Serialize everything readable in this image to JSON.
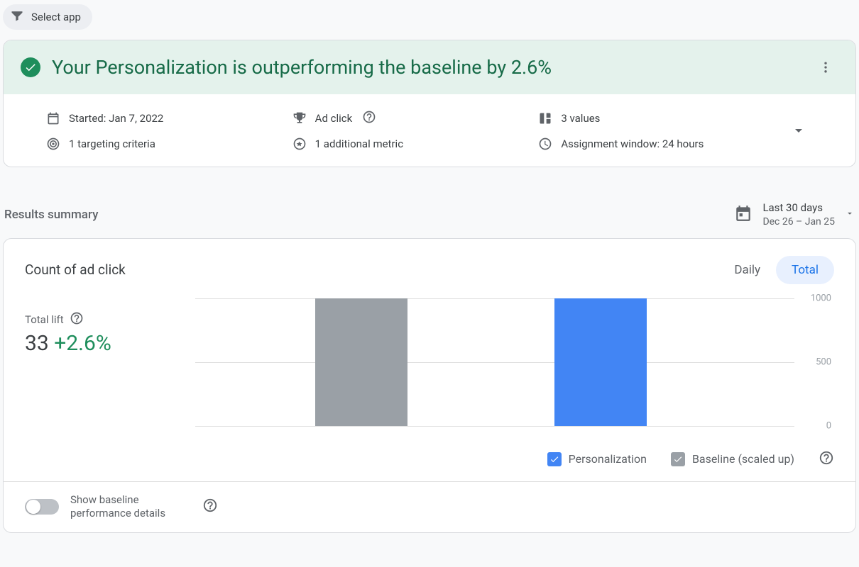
{
  "filter_chip": {
    "label": "Select app"
  },
  "banner": {
    "title": "Your Personalization is outperforming the baseline by 2.6%"
  },
  "meta": {
    "started": "Started: Jan 7, 2022",
    "goal_metric": "Ad click",
    "values": "3 values",
    "targeting": "1 targeting criteria",
    "additional_metric": "1 additional metric",
    "assignment_window": "Assignment window: 24 hours"
  },
  "section_title": "Results summary",
  "date_range": {
    "label": "Last 30 days",
    "range": "Dec 26 – Jan 25"
  },
  "chart": {
    "title": "Count of ad click",
    "tabs": {
      "daily": "Daily",
      "total": "Total",
      "active": "total"
    },
    "lift_label": "Total lift",
    "lift_value": "33",
    "lift_pct": "+2.6%",
    "legend": {
      "personalization": "Personalization",
      "baseline": "Baseline (scaled up)"
    }
  },
  "footer": {
    "switch_label": "Show baseline performance details"
  },
  "chart_data": {
    "type": "bar",
    "categories": [
      "Baseline (scaled up)",
      "Personalization"
    ],
    "values": [
      1000,
      1000
    ],
    "ylabel": "",
    "ylim": [
      0,
      1000
    ],
    "y_ticks": [
      0,
      500,
      1000
    ],
    "colors": {
      "Personalization": "#4285f4",
      "Baseline (scaled up)": "#9aa0a6"
    }
  }
}
